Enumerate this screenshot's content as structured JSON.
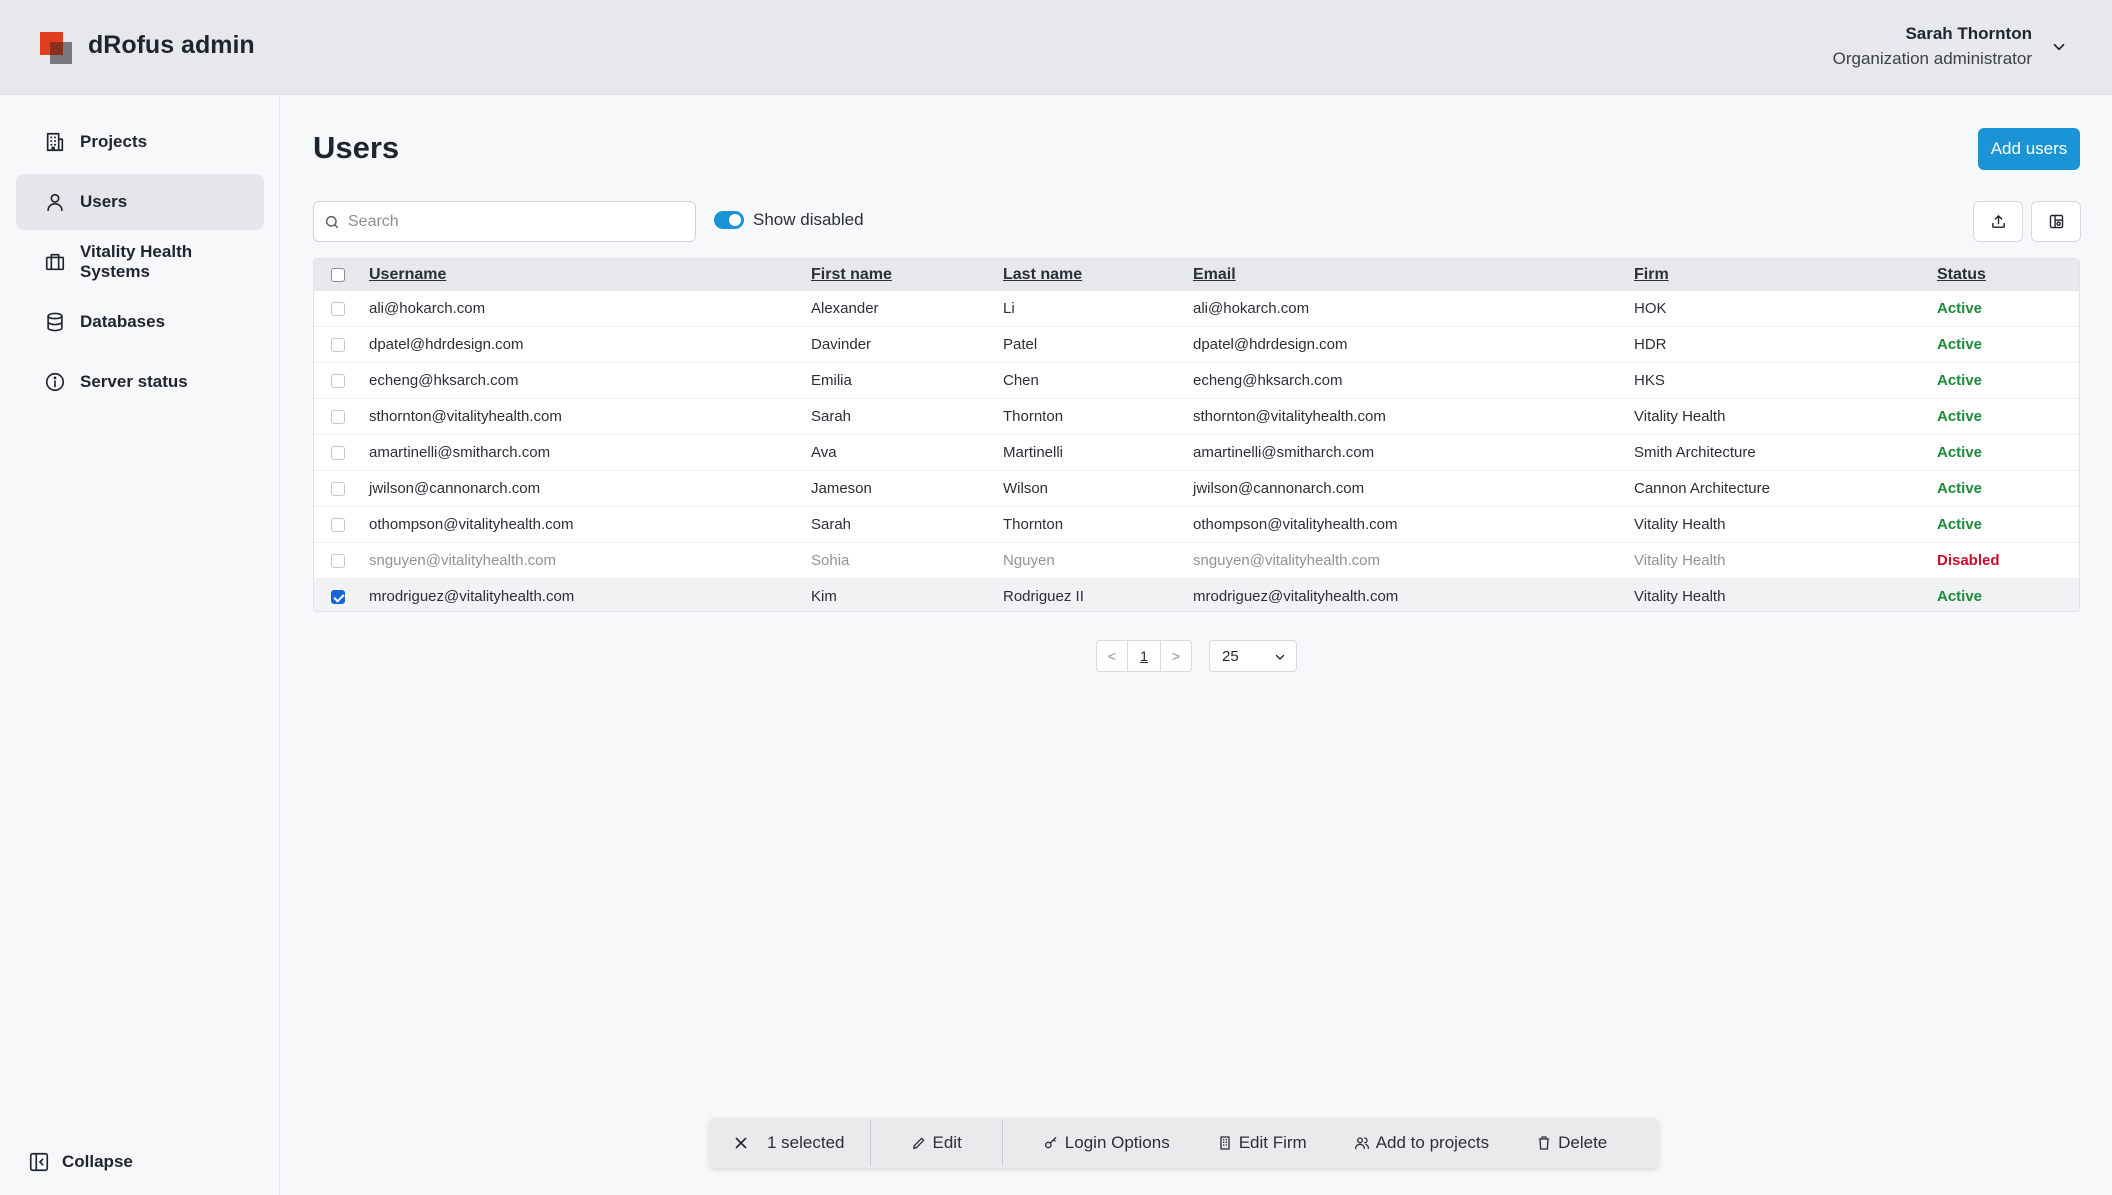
{
  "app": {
    "title": "dRofus admin"
  },
  "user": {
    "name": "Sarah Thornton",
    "role": "Organization administrator"
  },
  "sidebar": {
    "items": [
      {
        "label": "Projects",
        "icon": "building-icon"
      },
      {
        "label": "Users",
        "icon": "user-icon"
      },
      {
        "label": "Vitality Health Systems",
        "icon": "briefcase-icon"
      },
      {
        "label": "Databases",
        "icon": "database-icon"
      },
      {
        "label": "Server status",
        "icon": "info-icon"
      }
    ],
    "active": "Users",
    "collapse_label": "Collapse"
  },
  "main": {
    "title": "Users",
    "add_users_label": "Add users",
    "search_placeholder": "Search",
    "show_disabled_label": "Show disabled",
    "show_disabled_on": true
  },
  "table": {
    "columns": [
      "Username",
      "First name",
      "Last name",
      "Email",
      "Firm",
      "Status"
    ],
    "rows": [
      {
        "username": "ali@hokarch.com",
        "first": "Alexander",
        "last": "Li",
        "email": "ali@hokarch.com",
        "firm": "HOK",
        "status": "Active"
      },
      {
        "username": "dpatel@hdrdesign.com",
        "first": "Davinder",
        "last": "Patel",
        "email": "dpatel@hdrdesign.com",
        "firm": "HDR",
        "status": "Active"
      },
      {
        "username": "echeng@hksarch.com",
        "first": "Emilia",
        "last": "Chen",
        "email": "echeng@hksarch.com",
        "firm": "HKS",
        "status": "Active"
      },
      {
        "username": "sthornton@vitalityhealth.com",
        "first": "Sarah",
        "last": "Thornton",
        "email": "sthornton@vitalityhealth.com",
        "firm": "Vitality Health",
        "status": "Active"
      },
      {
        "username": "amartinelli@smitharch.com",
        "first": "Ava",
        "last": "Martinelli",
        "email": "amartinelli@smitharch.com",
        "firm": "Smith Architecture",
        "status": "Active"
      },
      {
        "username": "jwilson@cannonarch.com",
        "first": "Jameson",
        "last": "Wilson",
        "email": "jwilson@cannonarch.com",
        "firm": "Cannon Architecture",
        "status": "Active"
      },
      {
        "username": "othompson@vitalityhealth.com",
        "first": "Sarah",
        "last": "Thornton",
        "email": "othompson@vitalityhealth.com",
        "firm": "Vitality Health",
        "status": "Active"
      },
      {
        "username": "snguyen@vitalityhealth.com",
        "first": "Sohia",
        "last": "Nguyen",
        "email": "snguyen@vitalityhealth.com",
        "firm": "Vitality Health",
        "status": "Disabled"
      },
      {
        "username": "mrodriguez@vitalityhealth.com",
        "first": "Kim",
        "last": "Rodriguez II",
        "email": "mrodriguez@vitalityhealth.com",
        "firm": "Vitality Health",
        "status": "Active"
      }
    ],
    "selected_row": 8
  },
  "pagination": {
    "prev": "<",
    "page": "1",
    "next": ">",
    "page_size": "25"
  },
  "actionbar": {
    "selected_label": "1 selected",
    "edit_label": "Edit",
    "login_options_label": "Login Options",
    "edit_firm_label": "Edit Firm",
    "add_to_projects_label": "Add to projects",
    "delete_label": "Delete"
  },
  "colors": {
    "accent": "#1a94d6",
    "active": "#1e8a3a",
    "disabled": "#c8102e",
    "logo": "#e03e1f"
  }
}
